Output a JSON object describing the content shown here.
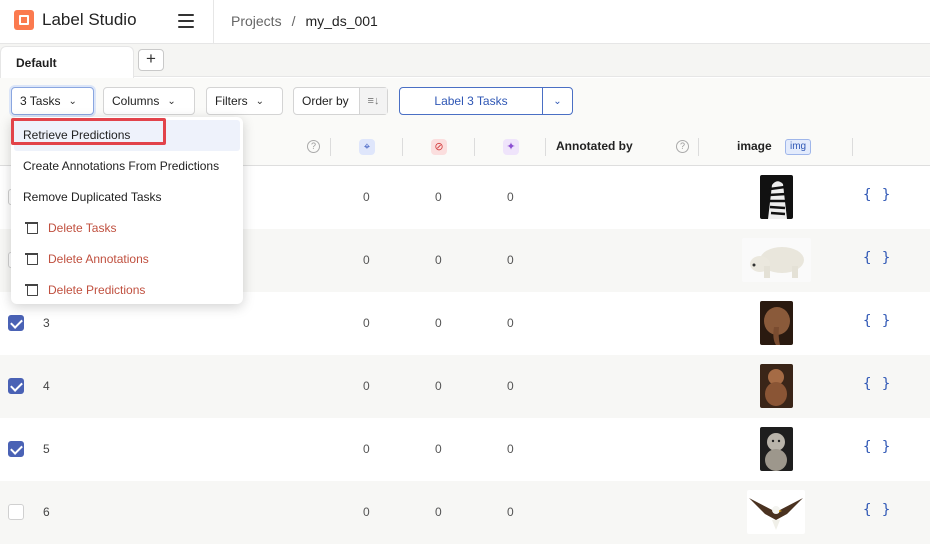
{
  "app": {
    "name": "Label Studio"
  },
  "breadcrumb": {
    "projects": "Projects",
    "separator": "/",
    "project": "my_ds_001"
  },
  "tabs": {
    "active": "Default",
    "add": "+"
  },
  "toolbar": {
    "tasks_label": "3 Tasks",
    "columns_label": "Columns",
    "filters_label": "Filters",
    "order_label": "Order by",
    "label_button": "Label 3 Tasks"
  },
  "table": {
    "headers": {
      "annotated_by": "Annotated by",
      "image": "image",
      "image_badge": "img"
    },
    "rows": [
      {
        "id": "",
        "checked": false,
        "a": "0",
        "b": "0",
        "c": "0",
        "img": "zebra"
      },
      {
        "id": "",
        "checked": false,
        "a": "0",
        "b": "0",
        "c": "0",
        "img": "polar-bear"
      },
      {
        "id": "3",
        "checked": true,
        "a": "0",
        "b": "0",
        "c": "0",
        "img": "elephant"
      },
      {
        "id": "4",
        "checked": true,
        "a": "0",
        "b": "0",
        "c": "0",
        "img": "monkey"
      },
      {
        "id": "5",
        "checked": true,
        "a": "0",
        "b": "0",
        "c": "0",
        "img": "baboon"
      },
      {
        "id": "6",
        "checked": false,
        "a": "0",
        "b": "0",
        "c": "0",
        "img": "eagle"
      }
    ],
    "json_label": "{ }"
  },
  "menu": {
    "items": [
      "Retrieve Predictions",
      "Create Annotations From Predictions",
      "Remove Duplicated Tasks",
      "Delete Tasks",
      "Delete Annotations",
      "Delete Predictions"
    ]
  },
  "colors": {
    "accent": "#4a62b5",
    "danger": "#c0503f",
    "highlight": "#e2434a",
    "brand": "#fb7a4f"
  }
}
